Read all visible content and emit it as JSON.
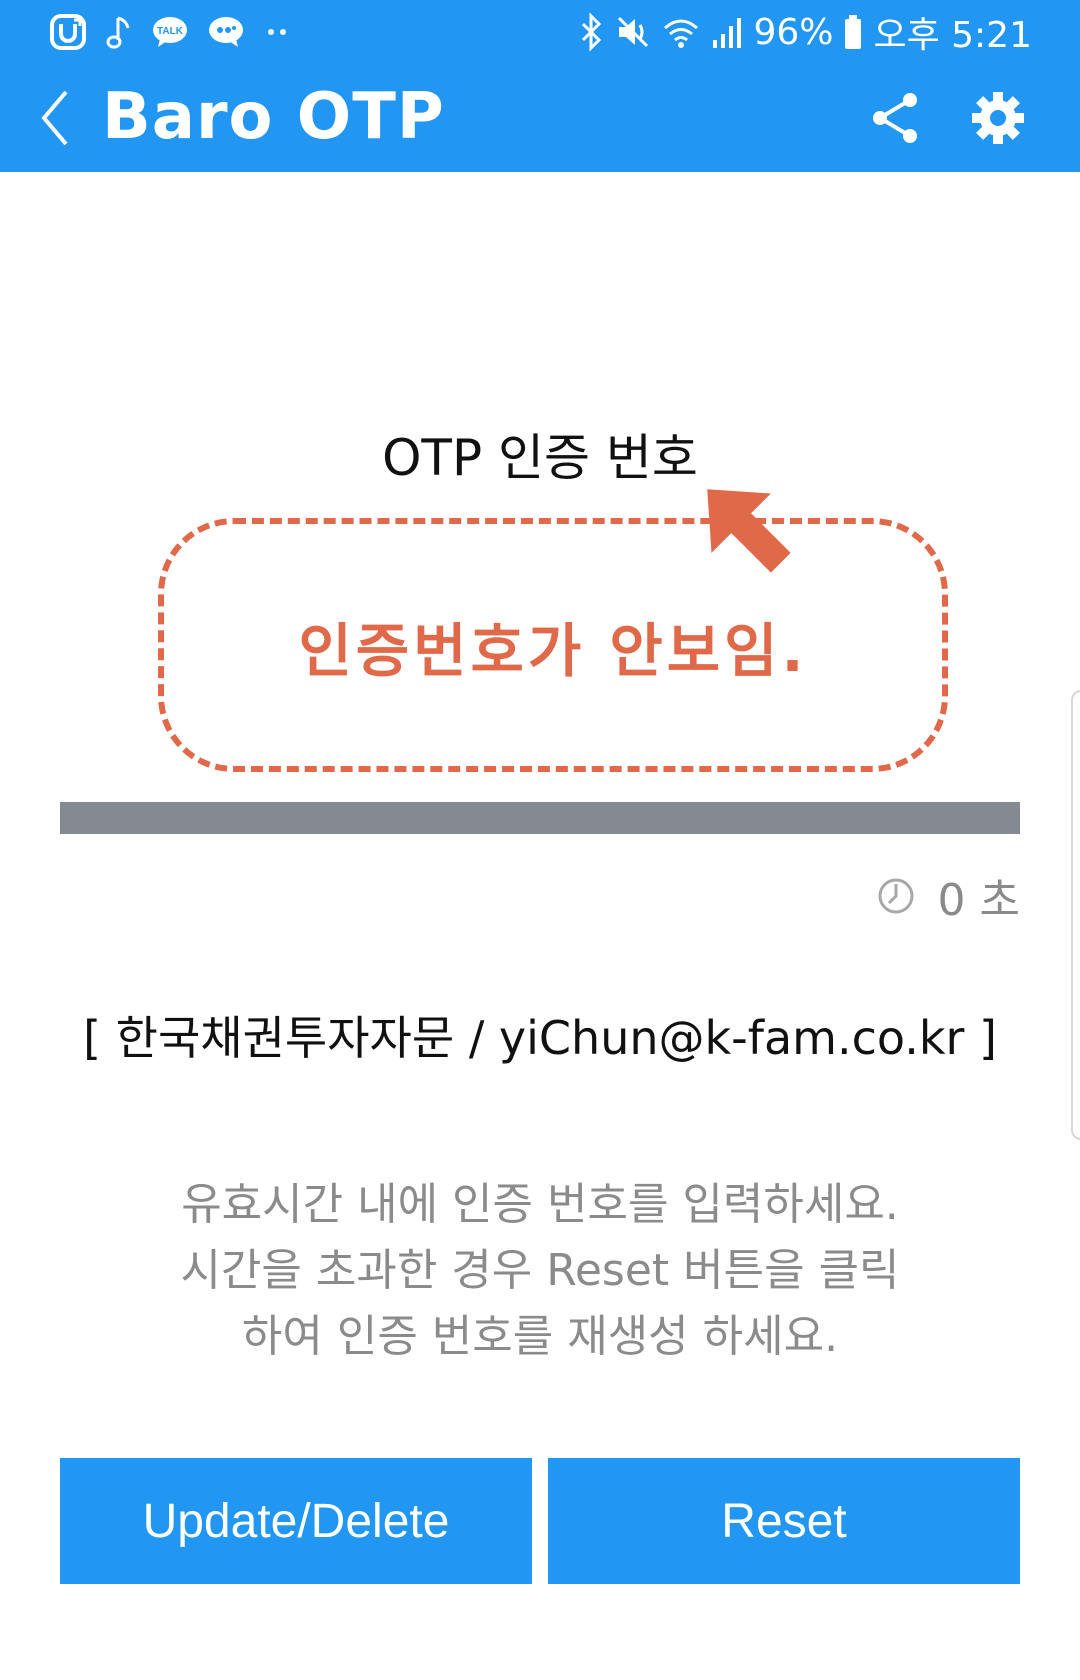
{
  "status_bar": {
    "left_icons": [
      "u-plus-icon",
      "music-note-icon",
      "kakaotalk-icon",
      "kakao-story-icon",
      "more-dots-icon"
    ],
    "bluetooth_icon": "bluetooth-icon",
    "mute_icon": "mute-icon",
    "wifi_icon": "wifi-icon",
    "signal_icon": "signal-icon",
    "battery_text": "96%",
    "battery_icon": "battery-icon",
    "time_text": "오후 5:21"
  },
  "toolbar": {
    "back_icon": "back-icon",
    "title": "Baro OTP",
    "share_icon": "share-icon",
    "settings_icon": "gear-icon"
  },
  "otp": {
    "label": "OTP 인증 번호",
    "message": "인증번호가 안보임.",
    "progress": 0
  },
  "timer": {
    "icon": "timer-icon",
    "value": "0",
    "unit": "초"
  },
  "account": {
    "text": "[ 한국채권투자자문 / yiChun@k-fam.co.kr ]"
  },
  "info": {
    "line1": "유효시간 내에 인증 번호를 입력하세요.",
    "line2": "시간을 초과한 경우 Reset 버튼을 클릭",
    "line3": "하여 인증 번호를 재생성 하세요."
  },
  "buttons": {
    "update_delete": "Update/Delete",
    "reset": "Reset"
  },
  "colors": {
    "primary": "#2196f3",
    "accent": "#e0694a",
    "progress_track": "#858a92",
    "secondary_text": "#8b8b8b"
  }
}
